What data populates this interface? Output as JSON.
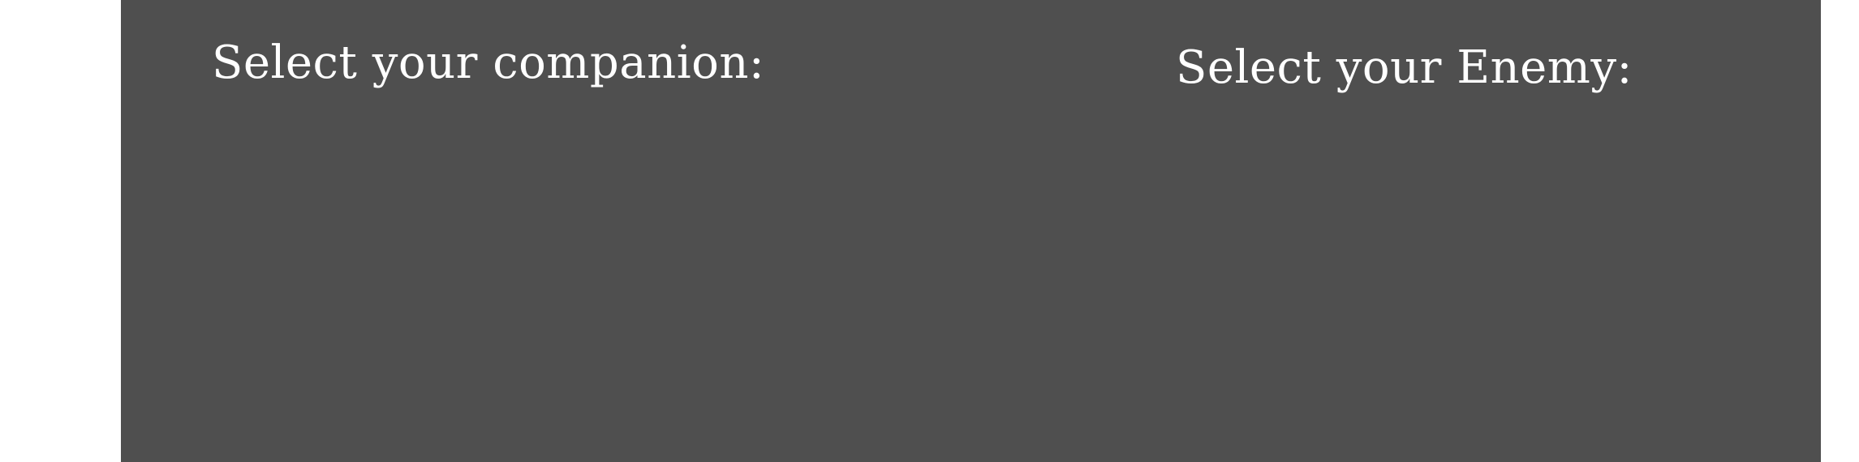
{
  "theme": {
    "stage_background": "#4f4f4f",
    "page_background": "#ffffff",
    "text_color": "#ffffff"
  },
  "companion_section": {
    "heading": "Select your companion:"
  },
  "enemy_section": {
    "heading": "Select your Enemy:"
  }
}
